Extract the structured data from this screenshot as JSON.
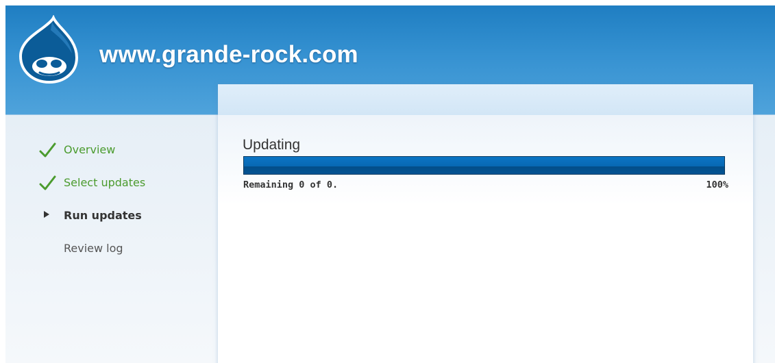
{
  "site": {
    "name": "www.grande-rock.com",
    "logo_icon": "drupal-drop-logo-icon"
  },
  "tasks": [
    {
      "label": "Overview",
      "status": "done",
      "icon": "checkmark-icon"
    },
    {
      "label": "Select updates",
      "status": "done",
      "icon": "checkmark-icon"
    },
    {
      "label": "Run updates",
      "status": "active",
      "icon": "arrow-right-icon"
    },
    {
      "label": "Review log",
      "status": "pending",
      "icon": ""
    }
  ],
  "progress": {
    "title": "Updating",
    "message": "Remaining 0 of 0.",
    "percentage_label": "100%",
    "fraction": 1.0
  },
  "colors": {
    "header_blue": "#2a87c8",
    "done_green": "#4b9b2e",
    "progress_blue": "#0868b3"
  }
}
